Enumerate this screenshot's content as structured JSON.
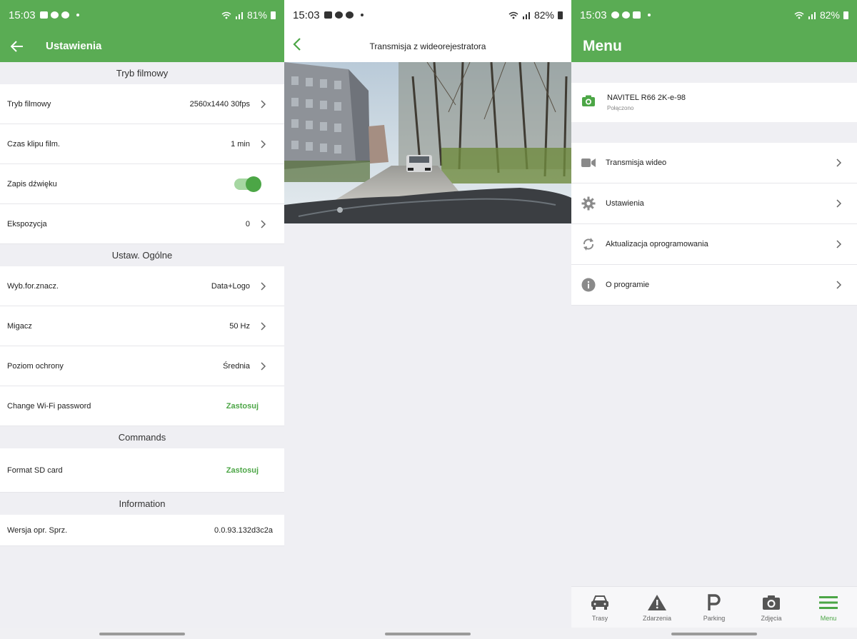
{
  "colors": {
    "accent": "#5aac54",
    "apply_text": "#4ca646"
  },
  "settings_screen": {
    "status": {
      "time": "15:03",
      "battery": "81%"
    },
    "title": "Ustawienia",
    "sections": [
      {
        "header": "Tryb filmowy",
        "rows": [
          {
            "label": "Tryb filmowy",
            "value": "2560x1440 30fps",
            "kind": "chevron"
          },
          {
            "label": "Czas klipu film.",
            "value": "1 min",
            "kind": "chevron"
          },
          {
            "label": "Zapis dźwięku",
            "value": "",
            "kind": "toggle",
            "on": true
          },
          {
            "label": "Ekspozycja",
            "value": "0",
            "kind": "chevron"
          }
        ]
      },
      {
        "header": "Ustaw. Ogólne",
        "rows": [
          {
            "label": "Wyb.for.znacz.",
            "value": "Data+Logo",
            "kind": "chevron"
          },
          {
            "label": "Migacz",
            "value": "50 Hz",
            "kind": "chevron"
          },
          {
            "label": "Poziom ochrony",
            "value": "Średnia",
            "kind": "chevron"
          },
          {
            "label": "Change Wi-Fi password",
            "value": "Zastosuj",
            "kind": "apply"
          }
        ]
      },
      {
        "header": "Commands",
        "rows": [
          {
            "label": "Format SD card",
            "value": "Zastosuj",
            "kind": "apply"
          }
        ]
      },
      {
        "header": "Information",
        "rows": [
          {
            "label": "Wersja opr. Sprz.",
            "value": "0.0.93.132d3c2a",
            "kind": "plain"
          }
        ]
      }
    ]
  },
  "video_screen": {
    "status": {
      "time": "15:03",
      "battery": "82%"
    },
    "title": "Transmisja z wideorejestratora"
  },
  "menu_screen": {
    "status": {
      "time": "15:03",
      "battery": "82%"
    },
    "title": "Menu",
    "device": {
      "name": "NAVITEL R66 2K-e-98",
      "status": "Połączono",
      "icon": "camera-icon"
    },
    "items": [
      {
        "label": "Transmisja wideo",
        "icon": "video-camera-icon"
      },
      {
        "label": "Ustawienia",
        "icon": "gear-icon"
      },
      {
        "label": "Aktualizacja oprogramowania",
        "icon": "sync-icon"
      },
      {
        "label": "O programie",
        "icon": "info-icon"
      }
    ],
    "bottom_nav": [
      {
        "label": "Trasy",
        "icon": "car-icon",
        "active": false
      },
      {
        "label": "Zdarzenia",
        "icon": "warning-icon",
        "active": false
      },
      {
        "label": "Parking",
        "icon": "parking-icon",
        "active": false
      },
      {
        "label": "Zdjęcia",
        "icon": "camera-icon",
        "active": false
      },
      {
        "label": "Menu",
        "icon": "hamburger-icon",
        "active": true
      }
    ]
  }
}
